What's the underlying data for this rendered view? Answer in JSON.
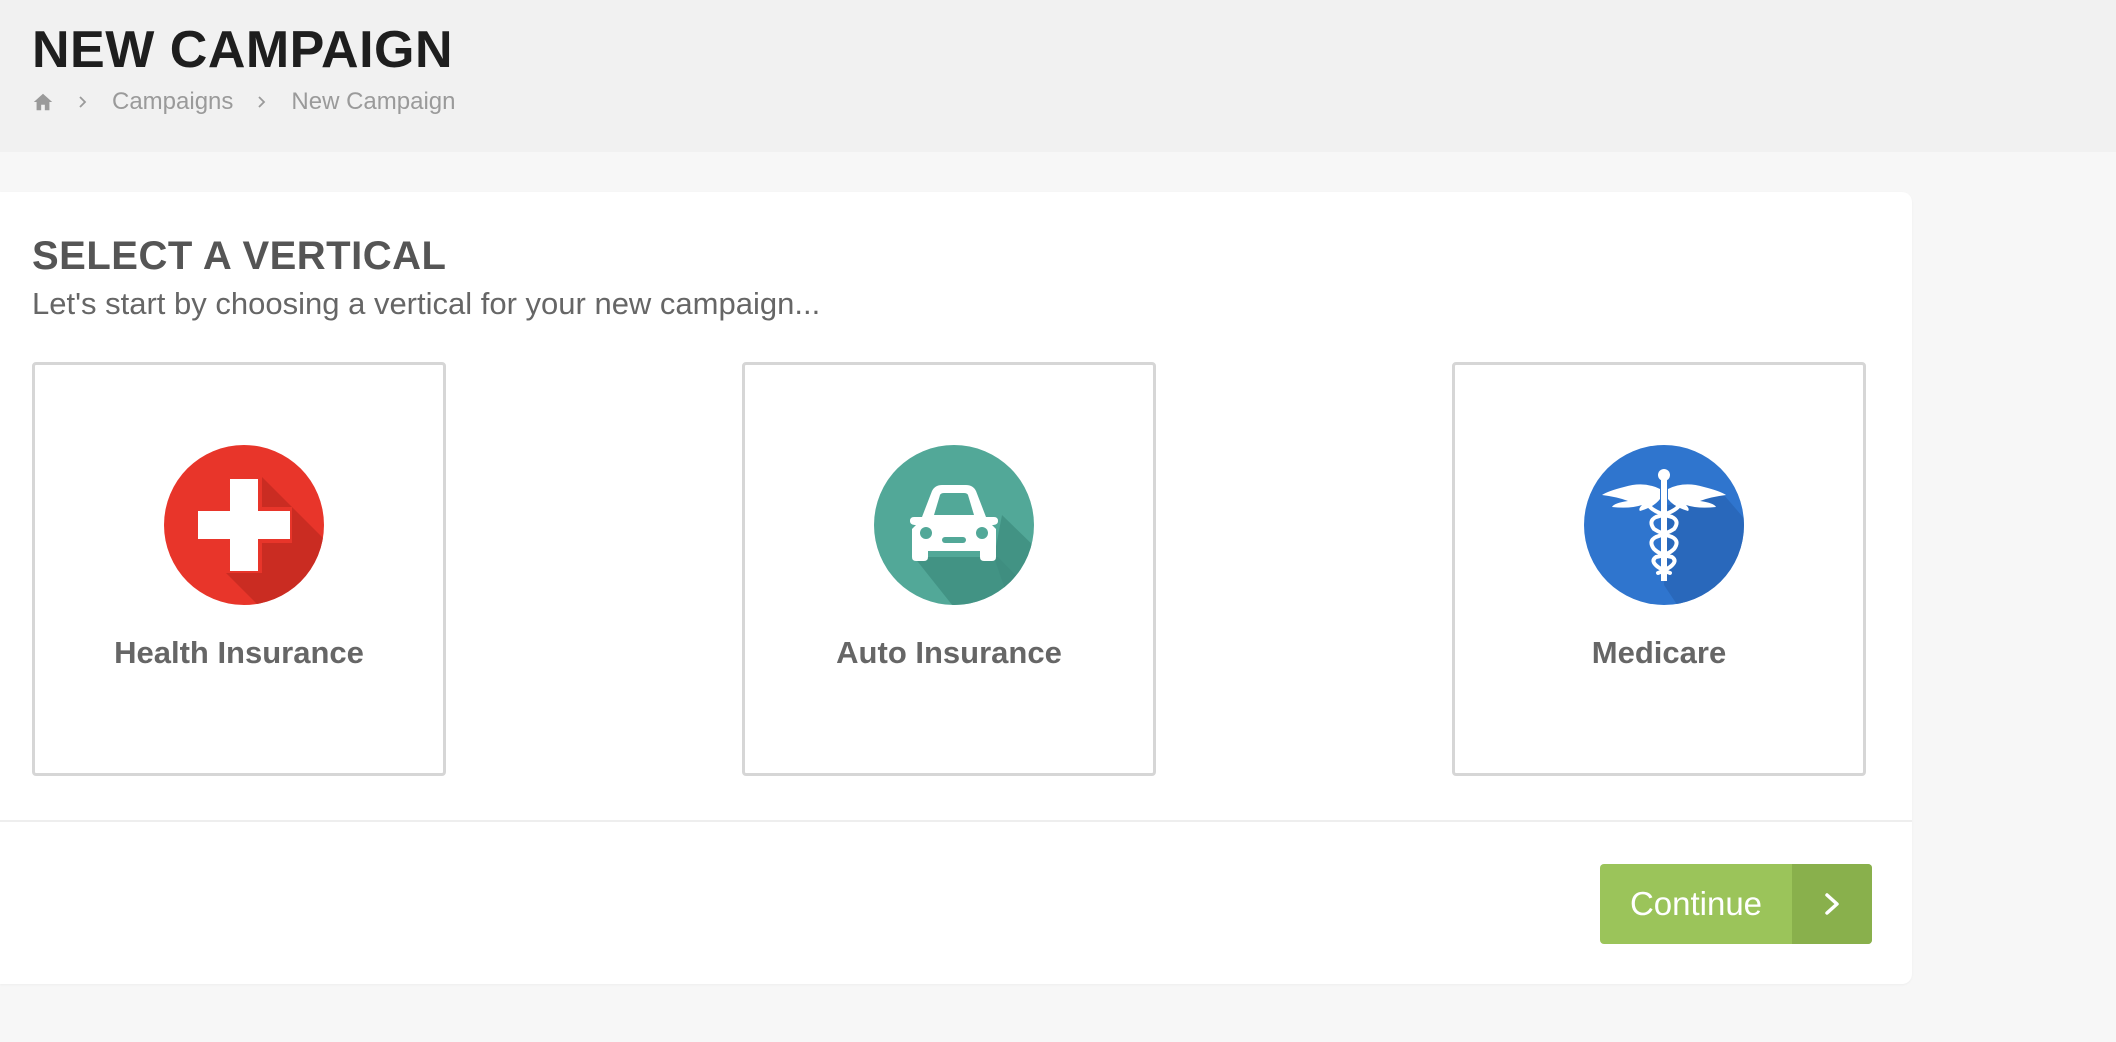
{
  "header": {
    "title": "NEW CAMPAIGN",
    "breadcrumb": {
      "home_icon": "home-icon",
      "items": [
        "Campaigns",
        "New Campaign"
      ]
    }
  },
  "card": {
    "title": "SELECT A VERTICAL",
    "subtitle": "Let's start by choosing a vertical for your new campaign...",
    "verticals": [
      {
        "label": "Health Insurance",
        "icon": "medical-cross-icon",
        "color": "#e8352a"
      },
      {
        "label": "Auto Insurance",
        "icon": "car-icon",
        "color": "#52a898"
      },
      {
        "label": "Medicare",
        "icon": "caduceus-icon",
        "color": "#2f75ce"
      }
    ],
    "continue_label": "Continue",
    "continue_color": "#9bc45a"
  }
}
